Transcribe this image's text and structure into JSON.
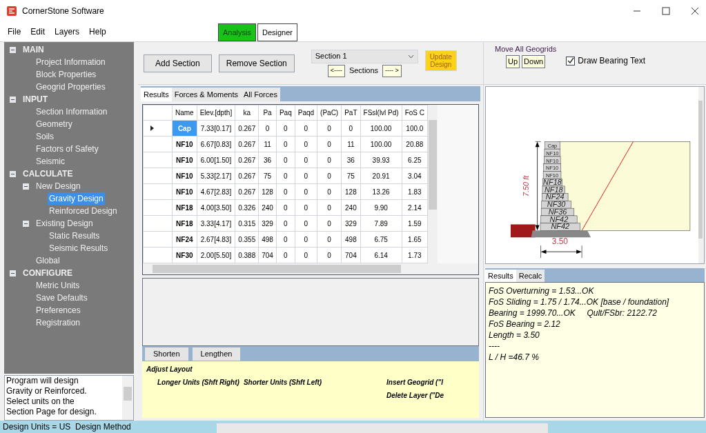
{
  "window": {
    "title": "CornerStone Software"
  },
  "menu": [
    "File",
    "Edit",
    "Layers",
    "Help"
  ],
  "mode_buttons": [
    {
      "label": "Analysis",
      "selected": true
    },
    {
      "label": "Designer",
      "selected": false
    }
  ],
  "tree": [
    {
      "label": "MAIN",
      "expanded": true,
      "selected": false,
      "children": [
        {
          "label": "Project Information",
          "selected": false
        },
        {
          "label": "Block Properties",
          "selected": false
        },
        {
          "label": "Geogrid Properties",
          "selected": false
        }
      ]
    },
    {
      "label": "INPUT",
      "expanded": true,
      "selected": false,
      "children": [
        {
          "label": "Section Information",
          "selected": false
        },
        {
          "label": "Geometry",
          "selected": false
        },
        {
          "label": "Soils",
          "selected": false
        },
        {
          "label": "Factors of Safety",
          "selected": false
        },
        {
          "label": "Seismic",
          "selected": false
        }
      ]
    },
    {
      "label": "CALCULATE",
      "expanded": true,
      "selected": false,
      "children": [
        {
          "label": "New Design",
          "expanded": true,
          "selected": false,
          "children": [
            {
              "label": "Gravity Design",
              "selected": true
            },
            {
              "label": "Reinforced Design",
              "selected": false
            }
          ]
        },
        {
          "label": "Existing Design",
          "expanded": true,
          "selected": false,
          "children": [
            {
              "label": "Static Results",
              "selected": false
            },
            {
              "label": "Seismic Results",
              "selected": false
            }
          ]
        },
        {
          "label": "Global",
          "selected": false
        }
      ]
    },
    {
      "label": "CONFIGURE",
      "expanded": true,
      "selected": false,
      "children": [
        {
          "label": "Metric Units",
          "selected": false
        },
        {
          "label": "Save Defaults",
          "selected": false
        },
        {
          "label": "Preferences",
          "selected": false
        },
        {
          "label": "Registration",
          "selected": false
        }
      ]
    }
  ],
  "help_text": [
    "Program will design",
    "Gravity or Reinforced.",
    "Select units on the",
    "Section Page for design."
  ],
  "status_bar": "Design Units = US  Design Method",
  "toolbar": {
    "add_section": "Add Section",
    "remove_section": "Remove Section",
    "section_select": "Section 1",
    "prev": "<----",
    "sections_label": "Sections",
    "next": "---- >",
    "update": "Update Design"
  },
  "geogrids": {
    "label": "Move All Geogrids",
    "up": "Up",
    "down": "Down",
    "draw_bearing": {
      "label": "Draw Bearing Text",
      "checked": true
    }
  },
  "tabs": [
    {
      "label": "Results",
      "selected": true
    },
    {
      "label": "Forces & Moments",
      "selected": false
    },
    {
      "label": "All Forces",
      "selected": false
    }
  ],
  "table": {
    "columns": [
      "Name",
      "Elev.[dpth]",
      "ka",
      "Pa",
      "Paq",
      "Paqd",
      "(PaC)",
      "PaT",
      "FSsl(lvl Pd)",
      "FoS C"
    ],
    "rows": [
      {
        "selected": true,
        "cells": [
          "Cap",
          "7.33[0.17]",
          "0.267",
          "0",
          "0",
          "0",
          "0",
          "0",
          "100.00",
          "100.0"
        ]
      },
      {
        "selected": false,
        "cells": [
          "NF10",
          "6.67[0.83]",
          "0.267",
          "11",
          "0",
          "0",
          "0",
          "11",
          "100.00",
          "20.88"
        ]
      },
      {
        "selected": false,
        "cells": [
          "NF10",
          "6.00[1.50]",
          "0.267",
          "36",
          "0",
          "0",
          "0",
          "36",
          "39.93",
          "6.25"
        ]
      },
      {
        "selected": false,
        "cells": [
          "NF10",
          "5.33[2.17]",
          "0.267",
          "75",
          "0",
          "0",
          "0",
          "75",
          "20.91",
          "3.04"
        ]
      },
      {
        "selected": false,
        "cells": [
          "NF10",
          "4.67[2.83]",
          "0.267",
          "128",
          "0",
          "0",
          "0",
          "128",
          "13.26",
          "1.83"
        ]
      },
      {
        "selected": false,
        "cells": [
          "NF18",
          "4.00[3.50]",
          "0.326",
          "240",
          "0",
          "0",
          "0",
          "240",
          "9.90",
          "2.14"
        ]
      },
      {
        "selected": false,
        "cells": [
          "NF18",
          "3.33[4.17]",
          "0.315",
          "329",
          "0",
          "0",
          "0",
          "329",
          "7.89",
          "1.59"
        ]
      },
      {
        "selected": false,
        "cells": [
          "NF24",
          "2.67[4.83]",
          "0.355",
          "498",
          "0",
          "0",
          "0",
          "498",
          "6.75",
          "1.65"
        ]
      },
      {
        "selected": false,
        "cells": [
          "NF30",
          "2.00[5.50]",
          "0.388",
          "704",
          "0",
          "0",
          "0",
          "704",
          "6.14",
          "1.73"
        ]
      }
    ]
  },
  "length_buttons": [
    "Shorten",
    "Lengthen"
  ],
  "hints": {
    "title": "Adjust Layout",
    "left": [
      "Longer Units (Shft Right)",
      "Shorter Units (Shft Left)"
    ],
    "right": [
      "Insert Geogrid (\"I",
      "Delete Layer (\"De"
    ]
  },
  "drawing": {
    "height_label": "7.50 ft",
    "length_label": "3.50",
    "blocks": [
      {
        "label": "Cap",
        "kind": "small"
      },
      {
        "label": "NF10",
        "kind": "small"
      },
      {
        "label": "NF10",
        "kind": "small"
      },
      {
        "label": "NF10",
        "kind": "small"
      },
      {
        "label": "NF10",
        "kind": "small"
      },
      {
        "label": "NF18",
        "kind": "large"
      },
      {
        "label": "NF18",
        "kind": "large"
      },
      {
        "label": "NF24",
        "kind": "large"
      },
      {
        "label": "NF30",
        "kind": "large"
      },
      {
        "label": "NF36",
        "kind": "large"
      },
      {
        "label": "NF42",
        "kind": "large"
      },
      {
        "label": "NF42",
        "kind": "large"
      }
    ]
  },
  "result_tabs": [
    {
      "label": "Results",
      "selected": true
    },
    {
      "label": "Recalc",
      "selected": false
    }
  ],
  "results": [
    "FoS Overturning = 1.53...OK",
    "FoS Sliding = 1.75 / 1.74...OK [base / foundation]",
    "Bearing = 1999.70...OK     Qult/FSbr: 2122.72",
    "FoS Bearing = 2.12",
    "Length = 3.50",
    "----",
    "L / H =46.7 %"
  ]
}
